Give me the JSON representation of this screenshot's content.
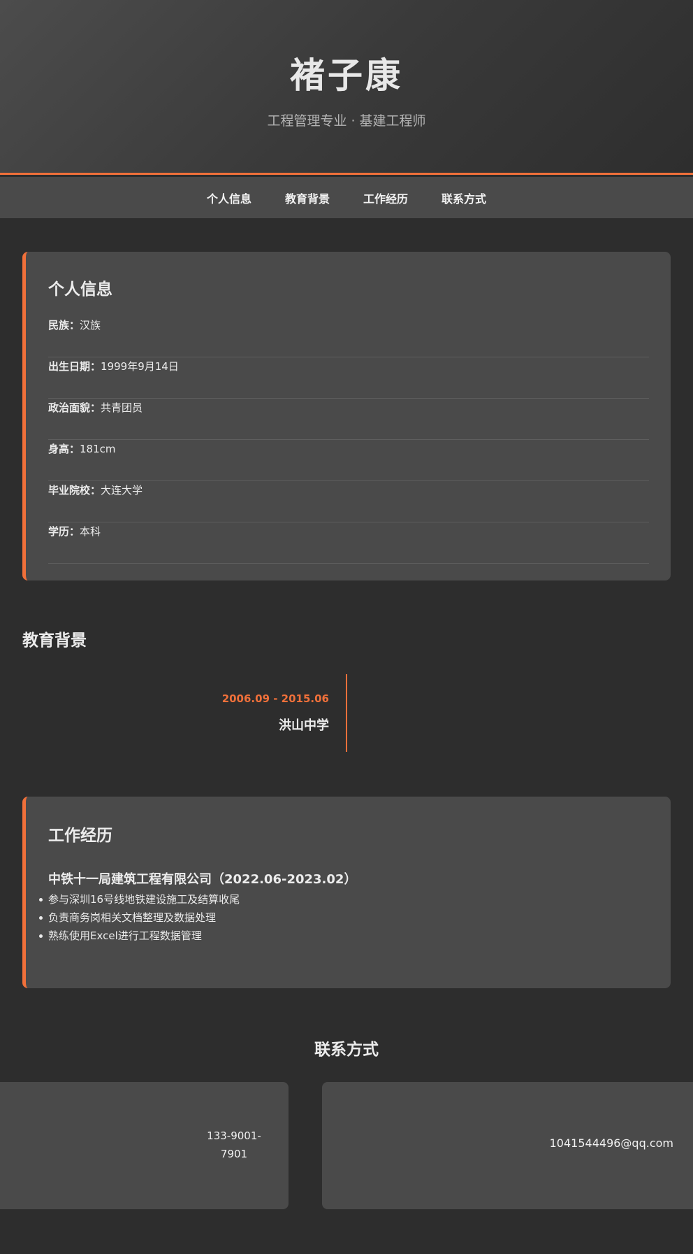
{
  "header": {
    "name": "褚子康",
    "subtitle": "工程管理专业 · 基建工程师"
  },
  "nav": {
    "items": [
      "个人信息",
      "教育背景",
      "工作经历",
      "联系方式"
    ]
  },
  "personal": {
    "title": "个人信息",
    "rows": [
      {
        "label": "民族：",
        "value": "汉族"
      },
      {
        "label": "出生日期：",
        "value": "1999年9月14日"
      },
      {
        "label": "政治面貌：",
        "value": "共青团员"
      },
      {
        "label": "身高：",
        "value": "181cm"
      },
      {
        "label": "毕业院校：",
        "value": "大连大学"
      },
      {
        "label": "学历：",
        "value": "本科"
      }
    ]
  },
  "education": {
    "title": "教育背景",
    "date": "2006.09 - 2015.06",
    "school": "洪山中学"
  },
  "work": {
    "title": "工作经历",
    "company": "中铁十一局建筑工程有限公司（2022.06-2023.02）",
    "duties": [
      "参与深圳16号线地铁建设施工及结算收尾",
      "负责商务岗相关文档整理及数据处理",
      "熟练使用Excel进行工程数据管理"
    ]
  },
  "contact": {
    "title": "联系方式",
    "phone": "133-9001-7901",
    "email": "1041544496@qq.com"
  },
  "colors": {
    "accent": "#f0703a",
    "background": "#2d2d2d",
    "card": "#4a4a4a"
  }
}
